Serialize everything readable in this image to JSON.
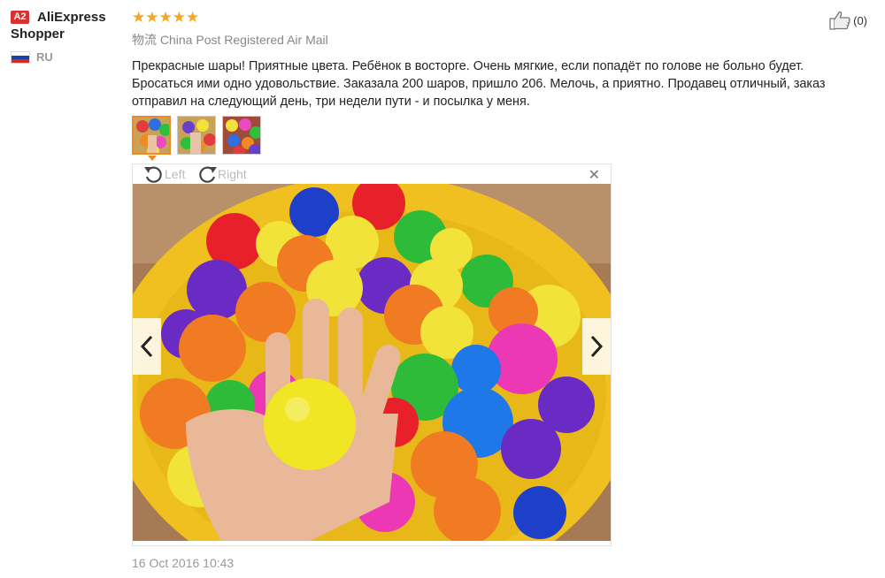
{
  "user": {
    "badge": "A2",
    "name_line1": "AliExpress",
    "name_line2": "Shopper",
    "country_code": "RU",
    "flag_colors": [
      "#ffffff",
      "#1c3fa8",
      "#d52b1e"
    ]
  },
  "review": {
    "rating": 5,
    "stars_text": "★★★★★",
    "star_color": "#f5a623",
    "shipping": "物流 China Post Registered Air Mail",
    "text": "Прекрасные шары! Приятные цвета. Ребёнок в восторге. Очень мягкие, если попадёт по голове не больно будет. Бросаться ими одно удовольствие. Заказала 200 шаров, пришло 206. Мелочь, а приятно. Продавец отличный, заказ отправил на следующий день, три недели пути - и посылка у меня.",
    "date": "16 Oct 2016 10:43"
  },
  "like": {
    "icon": "thumbs-up-icon",
    "count_label": "(0)"
  },
  "thumbnails": [
    {
      "label": "photo-1",
      "active": true
    },
    {
      "label": "photo-2",
      "active": false
    },
    {
      "label": "photo-3",
      "active": false
    }
  ],
  "viewer": {
    "rotate_left": "Left",
    "rotate_right": "Right",
    "close_icon": "close-icon",
    "prev_icon": "chevron-left-icon",
    "next_icon": "chevron-right-icon"
  },
  "accent_color": "#f08a24"
}
